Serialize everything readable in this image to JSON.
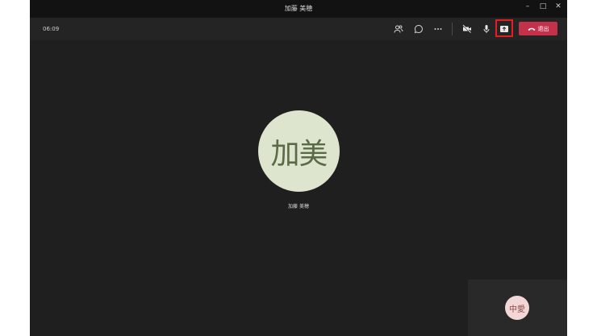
{
  "window": {
    "title": "加藤 美穂",
    "controls": [
      "–",
      "□",
      "✕"
    ]
  },
  "toolbar": {
    "timer": "06:09",
    "buttons": [
      {
        "name": "participants",
        "icon": "people-icon"
      },
      {
        "name": "chat",
        "icon": "chat-icon"
      },
      {
        "name": "more",
        "icon": "more-icon"
      },
      {
        "name": "camera",
        "icon": "video-off-icon"
      },
      {
        "name": "mic",
        "icon": "mic-icon"
      },
      {
        "name": "share",
        "icon": "share-screen-icon"
      }
    ],
    "leave_label": "退出",
    "leave_color": "#c4314b",
    "highlight_color": "#e51e25"
  },
  "main": {
    "avatar_initials": "加美",
    "participant_name": "加藤 美穂"
  },
  "self_view": {
    "avatar_initials": "中愛"
  }
}
